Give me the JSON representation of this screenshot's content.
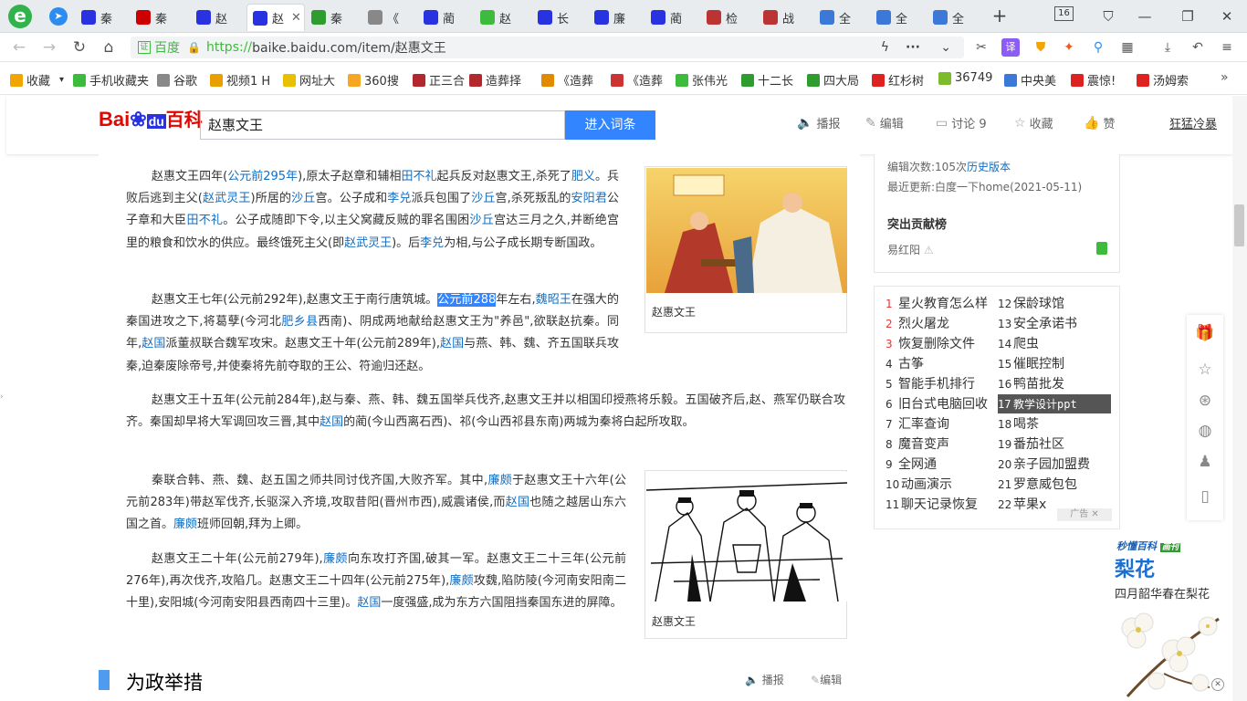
{
  "tabs": [
    {
      "label": "秦",
      "icon_color": "#2932e1",
      "icon": "baidu-paw-icon"
    },
    {
      "label": "秦",
      "icon_color": "#c00",
      "icon": "ipanda-icon"
    },
    {
      "label": "赵",
      "icon_color": "#2932e1",
      "icon": "baidu-paw-icon"
    },
    {
      "label": "赵",
      "icon_color": "#2932e1",
      "icon": "baidu-paw-icon"
    },
    {
      "label": "秦",
      "icon_color": "#2e9c2e",
      "icon": "guan-icon"
    },
    {
      "label": "《",
      "icon_color": "#888",
      "icon": "globe-icon"
    },
    {
      "label": "蔺",
      "icon_color": "#2932e1",
      "icon": "baidu-paw-icon"
    },
    {
      "label": "赵",
      "icon_color": "#3dbb3d",
      "icon": "360-icon"
    },
    {
      "label": "长",
      "icon_color": "#2932e1",
      "icon": "baidu-paw-icon"
    },
    {
      "label": "廉",
      "icon_color": "#2932e1",
      "icon": "baidu-paw-icon"
    },
    {
      "label": "蔺",
      "icon_color": "#2932e1",
      "icon": "baidu-paw-icon"
    },
    {
      "label": "检",
      "icon_color": "#b33",
      "icon": "zhihu-icon"
    },
    {
      "label": "战",
      "icon_color": "#b33",
      "icon": "zhihu-icon"
    },
    {
      "label": "全",
      "icon_color": "#3b78d8",
      "icon": "doc-icon"
    },
    {
      "label": "全",
      "icon_color": "#3b78d8",
      "icon": "doc-icon"
    },
    {
      "label": "全",
      "icon_color": "#3b78d8",
      "icon": "doc-icon"
    }
  ],
  "tab_count": "16",
  "address": {
    "site_label": "百度",
    "url_https": "https://",
    "url_rest": "baike.baidu.com/item/赵惠文王"
  },
  "bookmarks": [
    {
      "label": "收藏",
      "icon_color": "#f0a500"
    },
    {
      "label": "手机收藏夹",
      "icon_color": "#3dbb3d"
    },
    {
      "label": "谷歌",
      "icon_color": "#888"
    },
    {
      "label": "视频1 H",
      "icon_color": "#e8a000"
    },
    {
      "label": "网址大",
      "icon_color": "#e8c000"
    },
    {
      "label": "360搜",
      "icon_color": "#f5a623"
    },
    {
      "label": "正三合",
      "icon_color": "#b3282d"
    },
    {
      "label": "造葬择",
      "icon_color": "#b3282d"
    },
    {
      "label": "《造葬",
      "icon_color": "#e08a00"
    },
    {
      "label": "《造葬",
      "icon_color": "#c33"
    },
    {
      "label": "张伟光",
      "icon_color": "#3dbb3d"
    },
    {
      "label": "十二长",
      "icon_color": "#2e9c2e"
    },
    {
      "label": "四大局",
      "icon_color": "#2e9c2e"
    },
    {
      "label": "红杉树",
      "icon_color": "#d22"
    },
    {
      "label": "36749",
      "icon_color": "#7cbb2c"
    },
    {
      "label": "中央美",
      "icon_color": "#3b78d8"
    },
    {
      "label": "震惊!",
      "icon_color": "#d22"
    },
    {
      "label": "汤姆索",
      "icon_color": "#d22"
    }
  ],
  "baike": {
    "logo_text": "Bai",
    "logo_du": "du",
    "logo_baike": "百科",
    "search_value": "赵惠文王",
    "search_button": "进入词条",
    "actions": [
      "播报",
      "编辑",
      "讨论 9",
      "收藏",
      "赞"
    ],
    "user": "狂猛冷暴"
  },
  "paragraphs": [
    "赵惠文王四年(公元前295年),原太子赵章和辅相田不礼起兵反对赵惠文王,杀死了肥义。兵败后逃到主父(赵武灵王)所居的沙丘宫。公子成和李兑派兵包围了沙丘宫,杀死叛乱的安阳君公子章和大臣田不礼。公子成随即下令,以主父窝藏反贼的罪名围困沙丘宫达三月之久,并断绝宫里的粮食和饮水的供应。最终饿死主父(即赵武灵王)。后李兑为相,与公子成长期专断国政。",
    "赵惠文王七年(公元前292年),赵惠文王于南行唐筑城。公元前288年左右,魏昭王在强大的秦国进攻之下,将葛孽(今河北肥乡县西南)、阴成两地献给赵惠文王为\"养邑\",欲联赵抗秦。同年,赵国派董叔联合魏军攻宋。赵惠文王十年(公元前289年),赵国与燕、韩、魏、齐五国联兵攻秦,迫秦废除帝号,并使秦将先前夺取的王公、符逾归还赵。",
    "赵惠文王十五年(公元前284年),赵与秦、燕、韩、魏五国举兵伐齐,赵惠文王并以相国印授燕将乐毅。五国破齐后,赵、燕军仍联合攻齐。秦国却早将大军调回攻三晋,其中赵国的蔺(今山西离石西)、祁(今山西祁县东南)两城为秦将白起所攻取。",
    "秦联合韩、燕、魏、赵五国之师共同讨伐齐国,大败齐军。其中,廉颇于赵惠文王十六年(公元前283年)带赵军伐齐,长驱深入齐境,攻取昔阳(晋州市西),威震诸侯,而赵国也随之越居山东六国之首。廉颇班师回朝,拜为上卿。",
    "赵惠文王二十年(公元前279年),廉颇向东攻打齐国,破其一军。赵惠文王二十三年(公元前276年),再次伐齐,攻陷几。赵惠文王二十四年(公元前275年),廉颇攻魏,陷防陵(今河南安阳南二十里),安阳城(今河南安阳县西南四十三里)。赵国一度强盛,成为东方六国阻挡秦国东进的屏障。"
  ],
  "figures": [
    {
      "caption": "赵惠文王"
    },
    {
      "caption": "赵惠文王"
    }
  ],
  "section": {
    "title": "为政举措",
    "bobao": "播报",
    "edit": "编辑"
  },
  "side_info": {
    "edit_count_label": "编辑次数:",
    "edit_count": "105次",
    "history": "历史版本",
    "last_update": "最近更新:白度一下home(2021-05-11)",
    "contrib_title": "突出贡献榜",
    "contributor": "易红阳"
  },
  "ads": [
    {
      "n": "1",
      "t": "星火教育怎么样"
    },
    {
      "n": "2",
      "t": "烈火屠龙"
    },
    {
      "n": "3",
      "t": "恢复删除文件"
    },
    {
      "n": "4",
      "t": "古筝"
    },
    {
      "n": "5",
      "t": "智能手机排行"
    },
    {
      "n": "6",
      "t": "旧台式电脑回收"
    },
    {
      "n": "7",
      "t": "汇率查询"
    },
    {
      "n": "8",
      "t": "魔音变声"
    },
    {
      "n": "9",
      "t": "全网通"
    },
    {
      "n": "10",
      "t": "动画演示"
    },
    {
      "n": "11",
      "t": "聊天记录恢复"
    },
    {
      "n": "12",
      "t": "保龄球馆"
    },
    {
      "n": "13",
      "t": "安全承诺书"
    },
    {
      "n": "14",
      "t": "爬虫"
    },
    {
      "n": "15",
      "t": "催眠控制"
    },
    {
      "n": "16",
      "t": "鸭苗批发"
    },
    {
      "n": "17",
      "t": "教学设计ppt"
    },
    {
      "n": "18",
      "t": "喝茶"
    },
    {
      "n": "19",
      "t": "番茄社区"
    },
    {
      "n": "20",
      "t": "亲子园加盟费"
    },
    {
      "n": "21",
      "t": "罗意威包包"
    },
    {
      "n": "22",
      "t": "苹果x"
    }
  ],
  "ad_label": "广告",
  "promo": {
    "brand": "秒懂百科",
    "tag": "画刊",
    "title": "梨花",
    "subtitle": "四月韶华春在梨花"
  }
}
